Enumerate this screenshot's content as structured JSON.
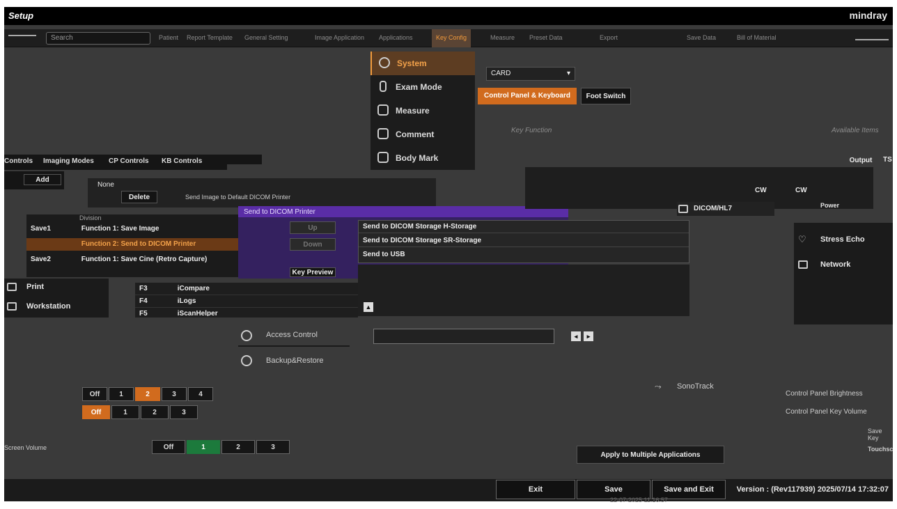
{
  "window": {
    "title": "Setup",
    "brand": "mindray"
  },
  "tabs": {
    "search_placeholder": "Search",
    "items": [
      "Patient",
      "Report Template",
      "General Setting",
      "Image Application",
      "Applications",
      "Key Config",
      "Measure",
      "Preset Data",
      "Export",
      "Save Data",
      "Bill of Material"
    ],
    "active": "Key Config"
  },
  "left_menu": {
    "items": [
      {
        "label": "System",
        "icon": "gear-icon"
      },
      {
        "label": "Exam Mode",
        "icon": "probe-icon"
      },
      {
        "label": "Measure",
        "icon": "ruler-icon"
      },
      {
        "label": "Comment",
        "icon": "comment-icon"
      },
      {
        "label": "Body Mark",
        "icon": "body-mark-icon"
      }
    ],
    "active": "System"
  },
  "exam_select": {
    "value": "CARD"
  },
  "key_tabs": {
    "control_panel": "Control Panel & Keyboard",
    "foot_switch": "Foot Switch"
  },
  "section_hints": {
    "key_function": "Key Function",
    "available_items": "Available Items"
  },
  "sub_tabs": [
    "Controls",
    "Imaging Modes",
    "CP Controls",
    "KB Controls"
  ],
  "output_label": "Output",
  "ts_label": "TS",
  "key_list": {
    "add": "Add",
    "delete": "Delete",
    "none": "None",
    "printer_text": "Send Image to Default DICOM Printer"
  },
  "assignments": {
    "header": "Division",
    "rows": [
      {
        "key": "Save1",
        "function": "Function 1: Save Image"
      },
      {
        "key": "",
        "function": "Function 2: Send to DICOM Printer"
      },
      {
        "key": "Save2",
        "function": "Function 1: Save Cine (Retro Capture)"
      }
    ],
    "selected_index": 1
  },
  "dicom_popup": {
    "title": "Send to DICOM Printer",
    "up": "Up",
    "down": "Down",
    "key_preview": "Key Preview"
  },
  "send_options": [
    "Send to DICOM Storage H-Storage",
    "Send to DICOM Storage SR-Storage",
    "Send to USB"
  ],
  "f_keys": [
    {
      "key": "F3",
      "function": "iCompare"
    },
    {
      "key": "F4",
      "function": "iLogs"
    },
    {
      "key": "F5",
      "function": "iScanHelper"
    }
  ],
  "left_side_items": [
    {
      "label": "Print",
      "icon": "printer-icon"
    },
    {
      "label": "Workstation",
      "icon": "workstation-icon"
    }
  ],
  "right_panel": {
    "cw": "CW",
    "dicom": "DICOM/HL7",
    "power": "Power",
    "items": [
      {
        "label": "Stress Echo",
        "icon": "heart-icon"
      },
      {
        "label": "Network",
        "icon": "network-icon"
      }
    ]
  },
  "center_menu": [
    {
      "label": "Access Control",
      "icon": "shield-icon"
    },
    {
      "label": "Backup&Restore",
      "icon": "restore-icon"
    }
  ],
  "sonotrack": {
    "label": "SonoTrack"
  },
  "brightness": {
    "label": "Control Panel Brightness",
    "key_volume": "Control Panel Key Volume",
    "save_key": "Save Key",
    "touchscreen": "Touchscr",
    "screen_volume": "Screen Volume"
  },
  "levels_row1": {
    "options": [
      "Off",
      "1",
      "2",
      "3",
      "4"
    ],
    "selected": "2"
  },
  "levels_row2": {
    "options": [
      "Off",
      "1",
      "2",
      "3"
    ],
    "selected": "Off"
  },
  "levels_row3": {
    "options": [
      "Off",
      "1",
      "2",
      "3"
    ],
    "selected": "1"
  },
  "apply_multiple": "Apply to Multiple Applications",
  "footer": {
    "exit": "Exit",
    "save": "Save",
    "save_exit": "Save and Exit",
    "version": "Version : (Rev117939) 2025/07/14 17:32:07",
    "timestamp": "22-07-2025 11:16:57"
  }
}
